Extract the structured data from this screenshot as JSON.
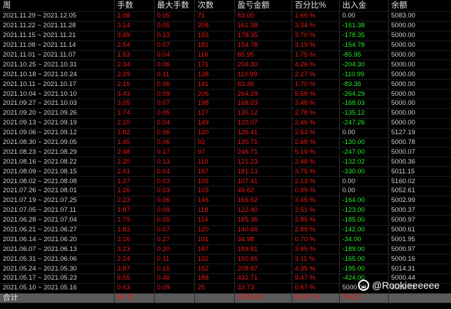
{
  "table": {
    "headers": [
      "周",
      "手数",
      "最大手数",
      "次数",
      "盈亏金额",
      "百分比%",
      "出入金",
      "余额"
    ],
    "rows": [
      [
        "2021.11.29 ~ 2021.12.05",
        "1.08",
        "0.05",
        "71",
        "83.00",
        "1.66 %",
        "0.00",
        "5083.00"
      ],
      [
        "2021.11.22 ~ 2021.11.28",
        "3.14",
        "0.05",
        "208",
        "161.38",
        "3.34 %",
        "-161.38",
        "5000.00"
      ],
      [
        "2021.11.15 ~ 2021.11.21",
        "3.49",
        "0.13",
        "193",
        "178.35",
        "3.70 %",
        "-178.35",
        "5000.00"
      ],
      [
        "2021.11.08 ~ 2021.11.14",
        "2.54",
        "0.07",
        "181",
        "154.78",
        "3.19 %",
        "-154.78",
        "5000.00"
      ],
      [
        "2021.11.01 ~ 2021.11.07",
        "1.53",
        "0.04",
        "116",
        "85.95",
        "1.75 %",
        "-85.95",
        "5000.00"
      ],
      [
        "2021.10.25 ~ 2021.10.31",
        "2.34",
        "0.06",
        "171",
        "204.30",
        "4.26 %",
        "-204.30",
        "5000.00"
      ],
      [
        "2021.10.18 ~ 2021.10.24",
        "2.29",
        "0.11",
        "138",
        "110.99",
        "2.27 %",
        "-110.99",
        "5000.00"
      ],
      [
        "2021.10.11 ~ 2021.10.17",
        "2.15",
        "0.06",
        "141",
        "83.36",
        "1.70 %",
        "-83.36",
        "5000.00"
      ],
      [
        "2021.10.04 ~ 2021.10.10",
        "3.43",
        "0.09",
        "206",
        "264.29",
        "5.58 %",
        "-264.29",
        "5000.00"
      ],
      [
        "2021.09.27 ~ 2021.10.03",
        "3.05",
        "0.07",
        "198",
        "168.03",
        "3.48 %",
        "-168.03",
        "5000.00"
      ],
      [
        "2021.09.20 ~ 2021.09.26",
        "1.74",
        "0.05",
        "127",
        "135.12",
        "2.78 %",
        "-135.12",
        "5000.00"
      ],
      [
        "2021.09.13 ~ 2021.09.19",
        "2.10",
        "0.04",
        "149",
        "120.07",
        "2.46 %",
        "-247.26",
        "5000.00"
      ],
      [
        "2021.09.06 ~ 2021.09.12",
        "1.82",
        "0.06",
        "120",
        "126.41",
        "2.53 %",
        "0.00",
        "5127.19"
      ],
      [
        "2021.08.30 ~ 2021.09.05",
        "1.45",
        "0.06",
        "92",
        "130.71",
        "2.68 %",
        "-130.00",
        "5000.78"
      ],
      [
        "2021.08.23 ~ 2021.08.29",
        "2.48",
        "0.17",
        "97",
        "246.71",
        "5.19 %",
        "-247.00",
        "5000.07"
      ],
      [
        "2021.08.16 ~ 2021.08.22",
        "2.20",
        "0.13",
        "110",
        "121.23",
        "2.48 %",
        "-132.02",
        "5000.36"
      ],
      [
        "2021.08.09 ~ 2021.08.15",
        "2.41",
        "0.04",
        "187",
        "181.13",
        "3.75 %",
        "-330.00",
        "5011.15"
      ],
      [
        "2021.08.02 ~ 2021.08.08",
        "1.27",
        "0.03",
        "105",
        "107.41",
        "2.13 %",
        "0.00",
        "5160.02"
      ],
      [
        "2021.07.26 ~ 2021.08.01",
        "1.26",
        "0.03",
        "103",
        "49.62",
        "0.99 %",
        "0.00",
        "5052.61"
      ],
      [
        "2021.07.19 ~ 2021.07.25",
        "2.23",
        "0.06",
        "146",
        "166.62",
        "3.45 %",
        "-164.00",
        "5002.99"
      ],
      [
        "2021.07.05 ~ 2021.07.11",
        "1.87",
        "0.09",
        "118",
        "122.40",
        "2.51 %",
        "-123.00",
        "5000.37"
      ],
      [
        "2021.06.28 ~ 2021.07.04",
        "1.79",
        "0.05",
        "114",
        "185.36",
        "3.85 %",
        "-185.00",
        "5000.97"
      ],
      [
        "2021.06.21 ~ 2021.06.27",
        "1.83",
        "0.07",
        "120",
        "140.66",
        "2.89 %",
        "-142.00",
        "5000.61"
      ],
      [
        "2021.06.14 ~ 2021.06.20",
        "3.16",
        "0.27",
        "101",
        "34.98",
        "0.70 %",
        "-34.00",
        "5001.95"
      ],
      [
        "2021.06.07 ~ 2021.06.13",
        "3.23",
        "0.20",
        "187",
        "189.81",
        "3.95 %",
        "-189.00",
        "5000.97"
      ],
      [
        "2021.05.31 ~ 2021.06.06",
        "2.24",
        "0.11",
        "132",
        "150.65",
        "3.11 %",
        "-165.00",
        "5000.16"
      ],
      [
        "2021.05.24 ~ 2021.05.30",
        "3.87",
        "0.15",
        "152",
        "208.87",
        "4.35 %",
        "-195.00",
        "5014.31"
      ],
      [
        "2021.05.17 ~ 2021.05.23",
        "6.55",
        "0.46",
        "188",
        "432.71",
        "9.47 %",
        "-424.00",
        "5000.44"
      ],
      [
        "2021.05.10 ~ 2021.05.16",
        "0.63",
        "0.09",
        "25",
        "33.73",
        "0.67 %",
        "5000.00",
        "5033.73"
      ]
    ],
    "total": [
      "合计",
      "69.17",
      "",
      "",
      "4378.83",
      "90.87 %",
      "704.17",
      ""
    ]
  },
  "watermark": {
    "text": "@Rookieeeeee",
    "icon": "weibo-logo-icon"
  },
  "colors": {
    "background": "#000000",
    "positive": "#f01818",
    "negative": "#26e826",
    "neutral": "#d0d0d0",
    "total_row": "#5a5a5a"
  }
}
